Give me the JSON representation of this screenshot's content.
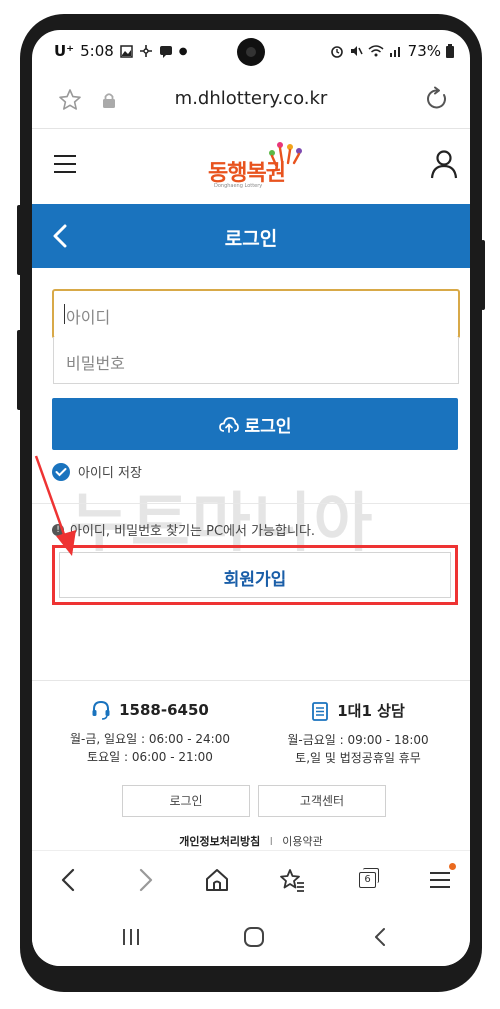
{
  "status_bar": {
    "carrier": "U⁺",
    "time": "5:08",
    "battery": "73%"
  },
  "browser": {
    "url": "m.dhlottery.co.kr",
    "tab_count": "6"
  },
  "site": {
    "logo_text": "동행복권",
    "logo_sub": "Donghaeng Lottery",
    "page_title": "로그인"
  },
  "form": {
    "id_placeholder": "아이디",
    "password_placeholder": "비밀번호",
    "login_label": "로그인",
    "save_id_label": "아이디 저장",
    "info_text": "아이디, 비밀번호 찾기는 PC에서 가능합니다.",
    "join_label": "회원가입"
  },
  "watermark": "누트마니아",
  "footer": {
    "phone": {
      "number": "1588-6450",
      "hours_line1": "월-금, 일요일 : 06:00 - 24:00",
      "hours_line2": "토요일 : 06:00 - 21:00"
    },
    "consult": {
      "title": "1대1 상담",
      "hours_line1": "월-금요일 : 09:00 - 18:00",
      "hours_line2": "토,일 및 법정공휴일 휴무"
    },
    "buttons": {
      "login": "로그인",
      "customer_center": "고객센터"
    },
    "links": {
      "privacy": "개인정보처리방침",
      "separator": "l",
      "terms": "이용약관"
    }
  },
  "colors": {
    "brand_blue": "#1a73be",
    "input_focus": "#d8a948",
    "highlight_red": "#e33333",
    "logo_orange": "#e8531e"
  }
}
